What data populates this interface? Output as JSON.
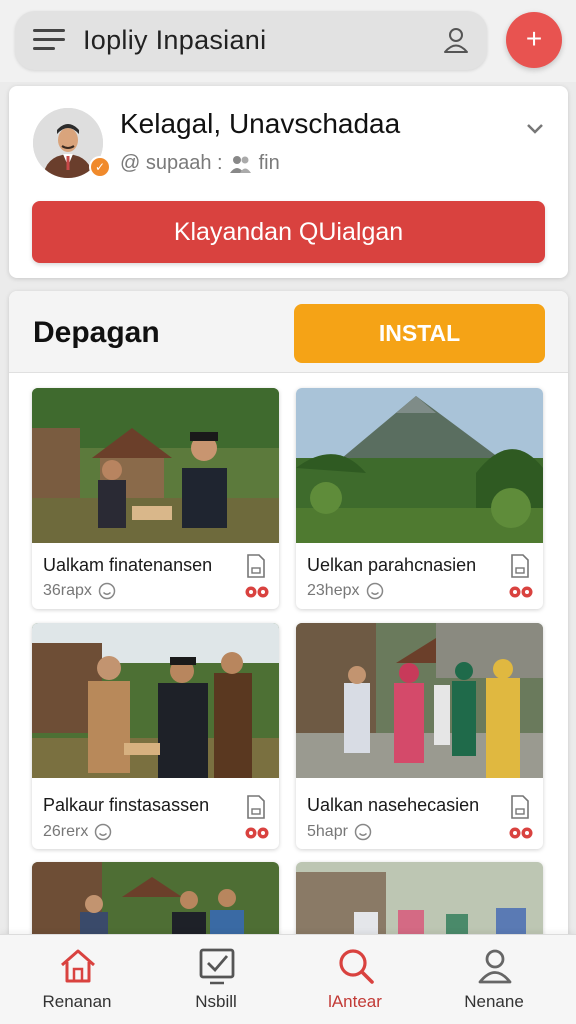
{
  "topbar": {
    "search_text": "Iopliy Inpasiani",
    "fab_label": "+"
  },
  "profile": {
    "name": "Kelagal, Unavschadaa",
    "handle": "@ supaah :",
    "followers": "fin",
    "primary_button": "Klayandan QUialgan"
  },
  "feed": {
    "title": "Depagan",
    "install_button": "INSTAL",
    "cards": [
      {
        "title": "Ualkam finatenansen",
        "meta": "36rapx"
      },
      {
        "title": "Uelkan parahcnasien",
        "meta": "23hepx"
      },
      {
        "title": "Palkaur finstasassen",
        "meta": "26rerx"
      },
      {
        "title": "Ualkan nasehecasien",
        "meta": "5hapr"
      },
      {
        "title": "",
        "meta": ""
      },
      {
        "title": "",
        "meta": ""
      }
    ]
  },
  "nav": {
    "items": [
      {
        "label": "Renanan",
        "icon": "home-icon"
      },
      {
        "label": "Nsbill",
        "icon": "check-square-icon"
      },
      {
        "label": "lAntear",
        "icon": "search-icon"
      },
      {
        "label": "Nenane",
        "icon": "user-icon"
      }
    ],
    "active": 2
  },
  "colors": {
    "accent_red": "#d9423f",
    "fab_red": "#e85350",
    "install_orange": "#f5a316",
    "active_nav": "#c23a36"
  }
}
